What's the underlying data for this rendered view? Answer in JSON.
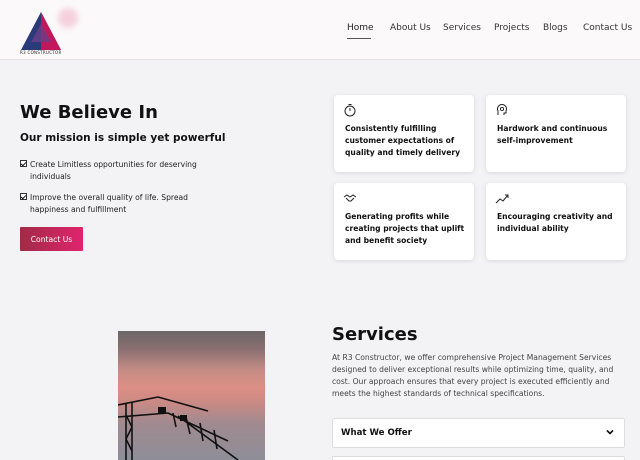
{
  "header": {
    "logo_text": "R3 CONSTRUCTOR",
    "nav": [
      {
        "label": "Home",
        "active": true
      },
      {
        "label": "About Us",
        "active": false
      },
      {
        "label": "Services",
        "active": false
      },
      {
        "label": "Projects",
        "active": false
      },
      {
        "label": "Blogs",
        "active": false
      },
      {
        "label": "Contact Us",
        "active": false
      }
    ]
  },
  "believe": {
    "title": "We Believe In",
    "subtitle": "Our mission is simple yet powerful",
    "checks": [
      "Create Limitless opportunities for deserving individuals",
      "Improve the overall quality of life. Spread happiness and fulfillment"
    ],
    "cta_label": "Contact Us",
    "cards": [
      {
        "icon": "stopwatch-icon",
        "text": "Consistently fulfilling customer expectations of quality and timely delivery"
      },
      {
        "icon": "head-gear-icon",
        "text": "Hardwork and continuous self-improvement"
      },
      {
        "icon": "handshake-icon",
        "text": "Generating profits while creating projects that uplift and benefit society"
      },
      {
        "icon": "trend-up-icon",
        "text": "Encouraging creativity and individual ability"
      }
    ]
  },
  "services": {
    "title": "Services",
    "description": "At R3 Constructor, we offer comprehensive Project Management Services designed to deliver exceptional results while optimizing time, quality, and cost. Our approach ensures that every project is executed efficiently and meets the highest standards of technical specifications.",
    "accordion_label": "What We Offer"
  },
  "colors": {
    "accent_gradient_start": "#a22a46",
    "accent_gradient_end": "#e0246d",
    "background": "#f3f3f5"
  }
}
